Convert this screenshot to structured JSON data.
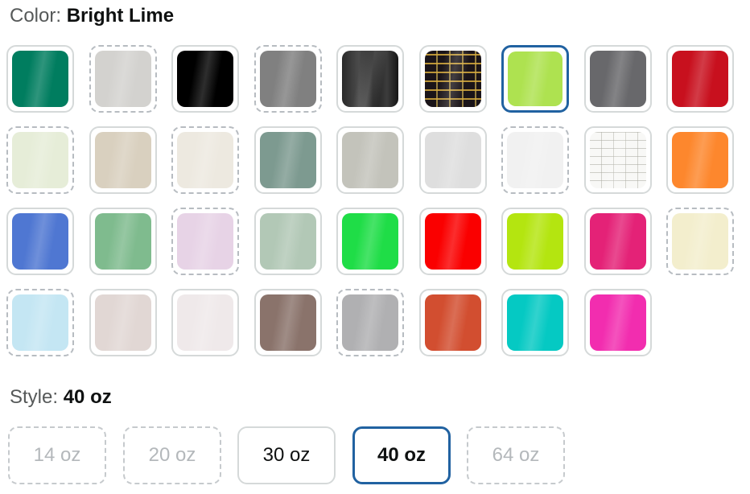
{
  "color_selector": {
    "label": "Color:",
    "selected_value": "Bright Lime",
    "swatches": [
      {
        "color": "#007d5f",
        "available": true
      },
      {
        "color": "#d3d2cf",
        "available": false
      },
      {
        "color": "#000000",
        "available": true
      },
      {
        "color": "#808080",
        "available": false
      },
      {
        "color": "#2b2b2b",
        "available": true,
        "style": "metal"
      },
      {
        "color": "#1a1418",
        "available": true,
        "style": "pattern-dark"
      },
      {
        "color": "#aee250",
        "available": true,
        "selected": true
      },
      {
        "color": "#68686b",
        "available": true
      },
      {
        "color": "#c8101e",
        "available": true
      },
      {
        "color": "#e6edd8",
        "available": false
      },
      {
        "color": "#d9d0bf",
        "available": true
      },
      {
        "color": "#ede9e0",
        "available": false
      },
      {
        "color": "#7d9a90",
        "available": true
      },
      {
        "color": "#c3c3bb",
        "available": true
      },
      {
        "color": "#dedede",
        "available": true
      },
      {
        "color": "#f1f1f1",
        "available": false
      },
      {
        "color": "#f8f8f6",
        "available": true,
        "style": "pattern-light"
      },
      {
        "color": "#fd872d",
        "available": true
      },
      {
        "color": "#4f77d2",
        "available": true
      },
      {
        "color": "#7fbb8e",
        "available": true
      },
      {
        "color": "#e7d3e6",
        "available": false
      },
      {
        "color": "#b2c8b6",
        "available": true
      },
      {
        "color": "#1fdd47",
        "available": true
      },
      {
        "color": "#fa0000",
        "available": true
      },
      {
        "color": "#b4e510",
        "available": true
      },
      {
        "color": "#e42277",
        "available": true
      },
      {
        "color": "#f3eecd",
        "available": false
      },
      {
        "color": "#c4e6f3",
        "available": false
      },
      {
        "color": "#e1d7d4",
        "available": true
      },
      {
        "color": "#efe9ea",
        "available": true
      },
      {
        "color": "#8a736b",
        "available": true
      },
      {
        "color": "#b0b0b2",
        "available": false
      },
      {
        "color": "#d24e30",
        "available": true
      },
      {
        "color": "#05c9c3",
        "available": true
      },
      {
        "color": "#f22daf",
        "available": true
      }
    ]
  },
  "style_selector": {
    "label": "Style:",
    "selected_value": "40 oz",
    "options": [
      {
        "label": "14 oz",
        "available": false
      },
      {
        "label": "20 oz",
        "available": false
      },
      {
        "label": "30 oz",
        "available": true
      },
      {
        "label": "40 oz",
        "available": true,
        "selected": true
      },
      {
        "label": "64 oz",
        "available": false
      }
    ]
  },
  "accent_color": "#2162a1"
}
